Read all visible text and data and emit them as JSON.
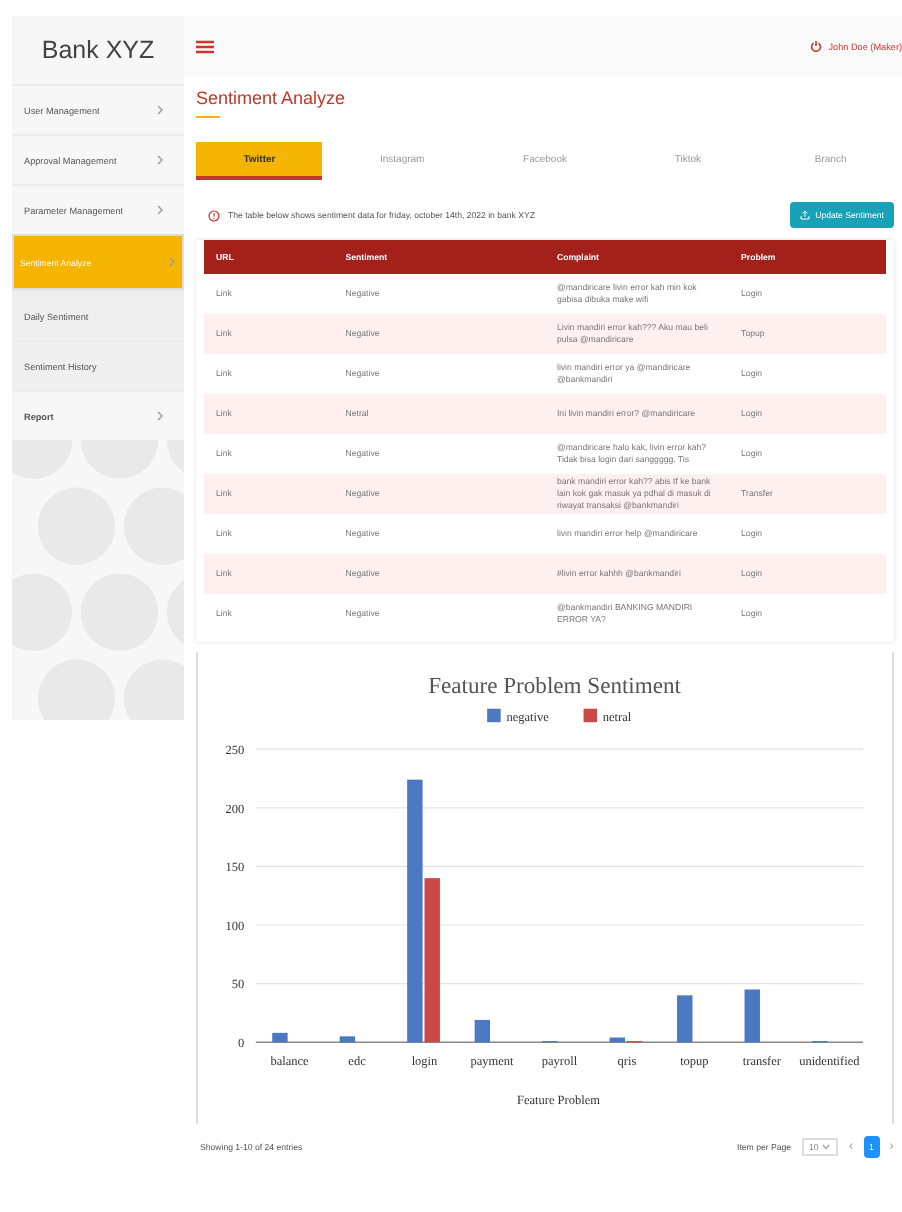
{
  "sidebar": {
    "brand": "Bank XYZ",
    "items": [
      {
        "label": "User Management",
        "kind": "menu",
        "selected": false
      },
      {
        "label": "Approval Management",
        "kind": "menu",
        "selected": false
      },
      {
        "label": "Parameter Management",
        "kind": "menu",
        "selected": false
      },
      {
        "label": "Sentiment Analyze",
        "kind": "menu",
        "selected": true
      },
      {
        "label": "Daily Sentiment",
        "kind": "submenu",
        "selected": false
      },
      {
        "label": "Sentiment History",
        "kind": "submenu",
        "selected": false
      },
      {
        "label": "Report",
        "kind": "group",
        "selected": false
      }
    ]
  },
  "header": {
    "user": "John Doe (Maker)"
  },
  "page_title": "Sentiment Analyze",
  "tabs": [
    {
      "label": "Twitter",
      "selected": true
    },
    {
      "label": "Instagram",
      "selected": false
    },
    {
      "label": "Facebook",
      "selected": false
    },
    {
      "label": "Tiktok",
      "selected": false
    },
    {
      "label": "Branch",
      "selected": false
    }
  ],
  "notice": "The table below shows sentiment data for friday, october 14th, 2022 in bank XYZ",
  "update_button": "Update Sentiment",
  "table": {
    "columns": [
      "URL",
      "Sentiment",
      "Complaint",
      "Problem"
    ],
    "rows": [
      [
        "Link",
        "Negative",
        "@mandiricare livin error kah min kok gabisa dibuka make wifi",
        "Login"
      ],
      [
        "Link",
        "Negative",
        "Livin mandiri error kah??? Aku mau beli pulsa @mandiricare",
        "Topup"
      ],
      [
        "Link",
        "Negative",
        "livin mandiri error ya @mandiricare @bankmandiri",
        "Login"
      ],
      [
        "Link",
        "Netral",
        "Ini livin mandiri error? @mandiricare",
        "Login"
      ],
      [
        "Link",
        "Negative",
        "@mandiricare halo kak, livin error kah? Tidak bisa login dari sanggggg. Tis",
        "Login"
      ],
      [
        "Link",
        "Negative",
        "bank mandiri error kah?? abis tf ke bank lain kok gak masuk ya pdhal di masuk di riwayat transaksi @bankmandiri",
        "Transfer"
      ],
      [
        "Link",
        "Negative",
        "livin mandiri error help @mandiricare",
        "Login"
      ],
      [
        "Link",
        "Negative",
        "#livin error kahhh @bankmandiri",
        "Login"
      ],
      [
        "Link",
        "Negative",
        "@bankmandiri BANKING MANDIRI ERROR YA?",
        "Login"
      ]
    ]
  },
  "chart_data": {
    "type": "bar",
    "title": "Feature Problem Sentiment",
    "xlabel": "Feature Problem",
    "categories": [
      "balance",
      "edc",
      "login",
      "payment",
      "payroll",
      "qris",
      "topup",
      "transfer",
      "unidentified"
    ],
    "series": [
      {
        "name": "negative",
        "color": "#4a78c2",
        "values": [
          8,
          5,
          224,
          19,
          1,
          4,
          40,
          45,
          1
        ]
      },
      {
        "name": "netral",
        "color": "#c94a45",
        "values": [
          0,
          0,
          140,
          0,
          0,
          1,
          0,
          0,
          0
        ]
      }
    ],
    "grid": true,
    "legend": true,
    "ylim": [
      0,
      250
    ],
    "yticks": [
      0,
      50,
      100,
      150,
      200,
      250
    ]
  },
  "footer": {
    "showing": "Showing 1-10 of 24 entries",
    "per_page_label": "Item per Page",
    "per_page": "10",
    "prev": "‹",
    "pages": [
      {
        "label": "1",
        "selected": true
      }
    ],
    "next": "›"
  }
}
